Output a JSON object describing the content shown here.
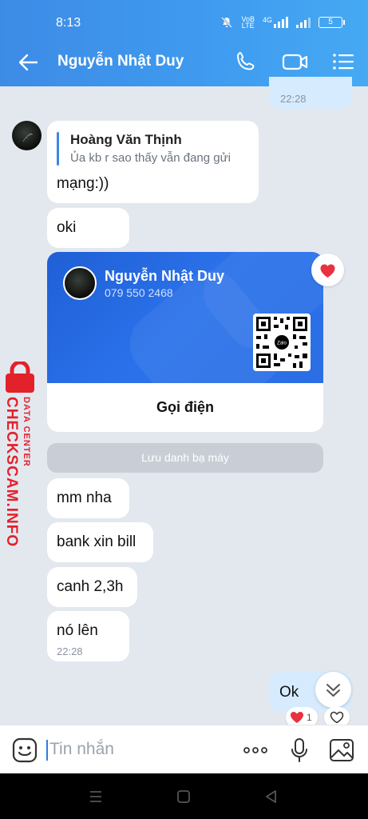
{
  "status": {
    "time": "8:13",
    "net_top": "VoB",
    "net_bottom": "LTE",
    "net_type": "4G",
    "battery": "5"
  },
  "header": {
    "title": "Nguyễn Nhật Duy",
    "icons": [
      "back-arrow-icon",
      "phone-icon",
      "video-icon",
      "menu-list-icon"
    ]
  },
  "messages": {
    "prev_time": "22:28",
    "quote": {
      "sender": "Hoàng Văn Thịnh",
      "text": "Ủa kb r sao thấy vẫn đang gửi"
    },
    "reply_text": "mạng:))",
    "m_oki": "oki",
    "card": {
      "name": "Nguyễn Nhật Duy",
      "phone": "079 550 2468",
      "call_label": "Gọi điện",
      "qr_logo": "Zalo"
    },
    "save_contact": "Lưu danh bạ máy",
    "m1": "mm nha",
    "m2": "bank xin bill",
    "m3": "canh 2,3h",
    "m4": "nó lên",
    "m4_time": "22:28",
    "out_ok": "Ok",
    "reaction_count": "1"
  },
  "watermark": {
    "site": "CHECKSCAM.INFO",
    "sub": "DATA CENTER"
  },
  "input": {
    "placeholder": "Tin nhắn"
  },
  "colors": {
    "header": "#3f9cf0",
    "accent": "#3b87e4",
    "card": "#2b72ea",
    "outgoing": "#d6ebfd",
    "watermark": "#e3212b"
  }
}
